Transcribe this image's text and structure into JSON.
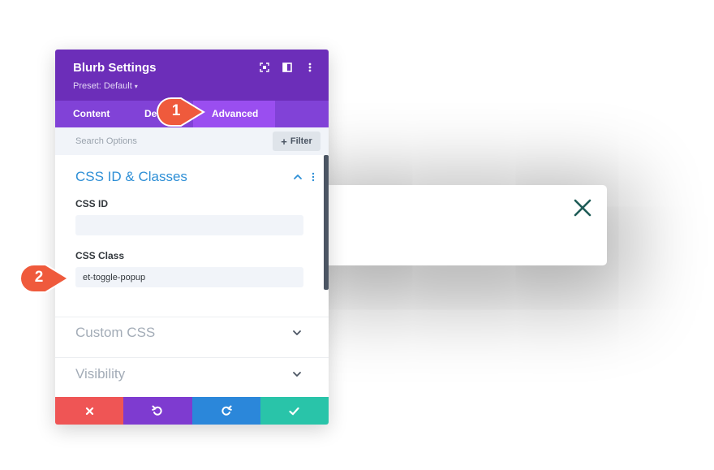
{
  "modal": {
    "title": "Blurb Settings",
    "preset_label": "Preset: Default",
    "header_colors": {
      "header": "#6c2eb9",
      "tabs": "#8142d7",
      "active_tab": "#9a4ef0"
    }
  },
  "tabs": [
    {
      "label": "Content",
      "active": false
    },
    {
      "label": "De",
      "active": false
    },
    {
      "label": "Advanced",
      "active": true
    }
  ],
  "search": {
    "placeholder": "Search Options",
    "filter_label": "Filter"
  },
  "sections": {
    "css_id_classes": {
      "title": "CSS ID & Classes",
      "expanded": true,
      "fields": {
        "css_id": {
          "label": "CSS ID",
          "value": ""
        },
        "css_class": {
          "label": "CSS Class",
          "value": "et-toggle-popup"
        }
      }
    },
    "custom_css": {
      "title": "Custom CSS",
      "expanded": false
    },
    "visibility": {
      "title": "Visibility",
      "expanded": false
    }
  },
  "footer": {
    "colors": {
      "cancel": "#ef5555",
      "undo": "#7e3bd0",
      "redo": "#2b87da",
      "save": "#29c4a9"
    },
    "icons": [
      "close-icon",
      "undo-icon",
      "redo-icon",
      "check-icon"
    ]
  },
  "callouts": [
    {
      "number": "1",
      "color": "#ef5a3c"
    },
    {
      "number": "2",
      "color": "#ef5a3c"
    }
  ],
  "popup": {
    "close_icon_color": "#1f5c57"
  }
}
